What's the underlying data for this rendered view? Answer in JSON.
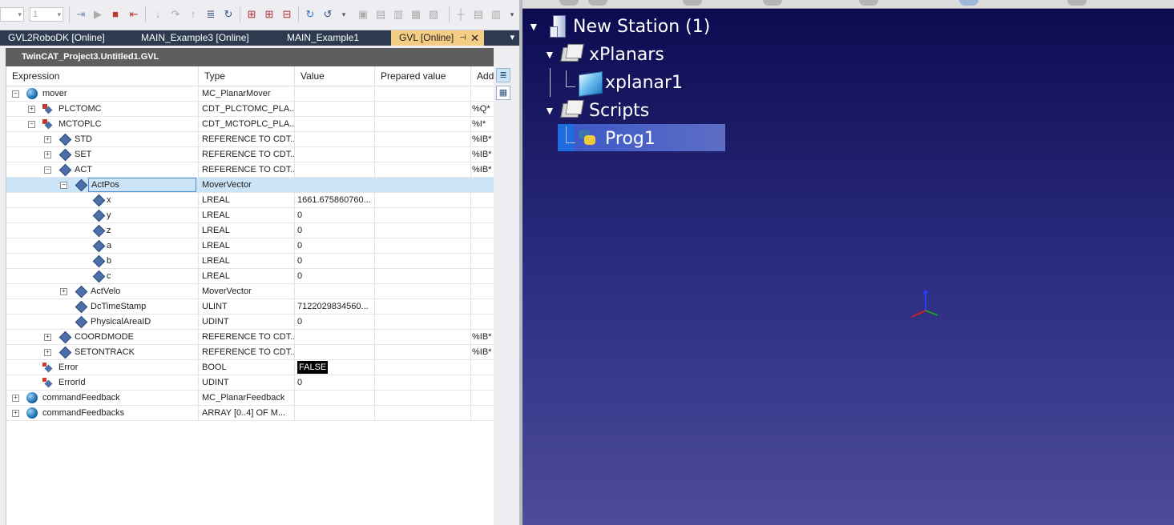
{
  "toolbar": {
    "combo1_value": "",
    "combo2_value": "1"
  },
  "tabs": [
    {
      "label": "GVL2RoboDK [Online]"
    },
    {
      "label": "MAIN_Example3 [Online]"
    },
    {
      "label": "MAIN_Example1"
    },
    {
      "label": "GVL [Online]"
    }
  ],
  "document": {
    "title": "TwinCAT_Project3.Untitled1.GVL"
  },
  "grid": {
    "columns": [
      "Expression",
      "Type",
      "Value",
      "Prepared value",
      "Add"
    ],
    "rows": [
      {
        "expr": "mover",
        "type": "MC_PlanarMover",
        "value": "",
        "addr": ""
      },
      {
        "expr": "PLCTOMC",
        "type": "CDT_PLCTOMC_PLA...",
        "value": "",
        "addr": "%Q*"
      },
      {
        "expr": "MCTOPLC",
        "type": "CDT_MCTOPLC_PLA...",
        "value": "",
        "addr": "%I*"
      },
      {
        "expr": "STD",
        "type": "REFERENCE TO CDT...",
        "value": "",
        "addr": "%IB*"
      },
      {
        "expr": "SET",
        "type": "REFERENCE TO CDT...",
        "value": "",
        "addr": "%IB*"
      },
      {
        "expr": "ACT",
        "type": "REFERENCE TO CDT...",
        "value": "",
        "addr": "%IB*"
      },
      {
        "expr": "ActPos",
        "type": "MoverVector",
        "value": "",
        "addr": ""
      },
      {
        "expr": "x",
        "type": "LREAL",
        "value": "1661.675860760...",
        "addr": ""
      },
      {
        "expr": "y",
        "type": "LREAL",
        "value": "0",
        "addr": ""
      },
      {
        "expr": "z",
        "type": "LREAL",
        "value": "0",
        "addr": ""
      },
      {
        "expr": "a",
        "type": "LREAL",
        "value": "0",
        "addr": ""
      },
      {
        "expr": "b",
        "type": "LREAL",
        "value": "0",
        "addr": ""
      },
      {
        "expr": "c",
        "type": "LREAL",
        "value": "0",
        "addr": ""
      },
      {
        "expr": "ActVelo",
        "type": "MoverVector",
        "value": "",
        "addr": ""
      },
      {
        "expr": "DcTimeStamp",
        "type": "ULINT",
        "value": "7122029834560...",
        "addr": ""
      },
      {
        "expr": "PhysicalAreaID",
        "type": "UDINT",
        "value": "0",
        "addr": ""
      },
      {
        "expr": "COORDMODE",
        "type": "REFERENCE TO CDT...",
        "value": "",
        "addr": "%IB*"
      },
      {
        "expr": "SETONTRACK",
        "type": "REFERENCE TO CDT...",
        "value": "",
        "addr": "%IB*"
      },
      {
        "expr": "Error",
        "type": "BOOL",
        "value": "FALSE",
        "addr": ""
      },
      {
        "expr": "ErrorId",
        "type": "UDINT",
        "value": "0",
        "addr": ""
      },
      {
        "expr": "commandFeedback",
        "type": "MC_PlanarFeedback",
        "value": "",
        "addr": ""
      },
      {
        "expr": "commandFeedbacks",
        "type": "ARRAY [0..4] OF M...",
        "value": "",
        "addr": ""
      }
    ]
  },
  "station_tree": {
    "station": "New Station (1)",
    "folder1": "xPlanars",
    "item1": "xplanar1",
    "folder2": "Scripts",
    "item2": "Prog1"
  },
  "colors": {
    "tab_bar": "#2d3a50",
    "active_tab": "#f5cc84",
    "selection": "#cce4f7",
    "viewport_top": "#0a0a50",
    "viewport_bottom": "#4d4b9a"
  }
}
